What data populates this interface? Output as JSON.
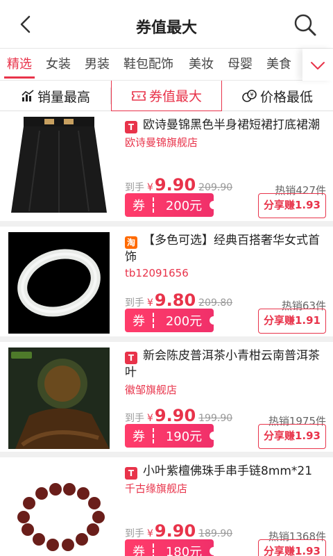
{
  "header": {
    "title": "券值最大",
    "back_icon": "chevron-left-icon",
    "search_icon": "search-icon"
  },
  "categories": [
    "精选",
    "女装",
    "男装",
    "鞋包配饰",
    "美妆",
    "母婴",
    "美食"
  ],
  "sort_tabs": [
    {
      "label": "销量最高",
      "icon": "bar-chart-icon"
    },
    {
      "label": "券值最大",
      "icon": "coupon-icon",
      "active": true
    },
    {
      "label": "价格最低",
      "icon": "coins-icon"
    }
  ],
  "products": [
    {
      "source": "天猫",
      "badge_char": "T",
      "title": "欧诗曼锦黑色半身裙短裙打底裙潮",
      "shop": "欧诗曼锦旗舰店",
      "arrive_label": "到手",
      "currency": "¥",
      "price": "9.90",
      "original_price": "209.90",
      "sales": "热销427件",
      "coupon_label": "券",
      "coupon_amount": "200元",
      "share_label": "分享赚1.93"
    },
    {
      "source": "淘宝",
      "badge_char": "淘",
      "title": "【多色可选】经典百搭奢华女式首饰",
      "shop": "tb12091656",
      "arrive_label": "到手",
      "currency": "¥",
      "price": "9.80",
      "original_price": "209.80",
      "sales": "热销63件",
      "coupon_label": "券",
      "coupon_amount": "200元",
      "share_label": "分享赚1.91"
    },
    {
      "source": "天猫",
      "badge_char": "T",
      "title": "新会陈皮普洱茶小青柑云南普洱茶叶",
      "shop": "徽邹旗舰店",
      "arrive_label": "到手",
      "currency": "¥",
      "price": "9.90",
      "original_price": "199.90",
      "sales": "热销1975件",
      "coupon_label": "券",
      "coupon_amount": "190元",
      "share_label": "分享赚1.93"
    },
    {
      "source": "天猫",
      "badge_char": "T",
      "title": "小叶紫檀佛珠手串手链8mm*21",
      "shop": "千古缘旗舰店",
      "arrive_label": "到手",
      "currency": "¥",
      "price": "9.90",
      "original_price": "189.90",
      "sales": "热销1368件",
      "coupon_label": "券",
      "coupon_amount": "180元",
      "share_label": "分享赚1.93"
    }
  ],
  "colors": {
    "accent": "#e8334a",
    "taobao": "#ff6a00"
  }
}
